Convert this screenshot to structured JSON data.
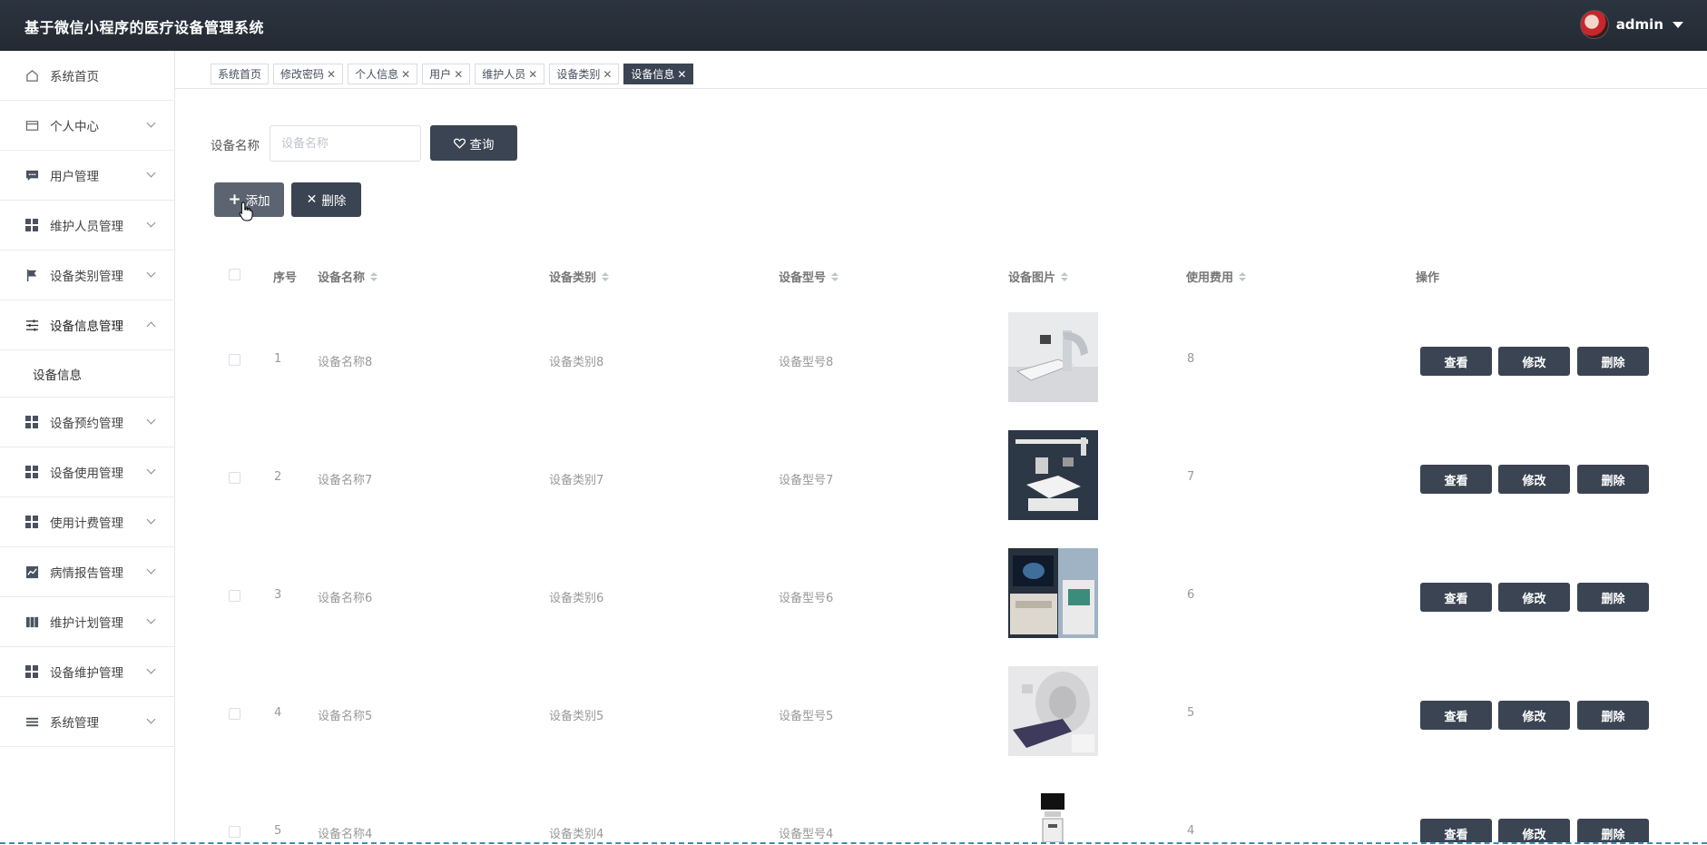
{
  "header": {
    "title": "基于微信小程序的医疗设备管理系统",
    "username": "admin"
  },
  "sidebar": {
    "items": [
      {
        "label": "系统首页",
        "icon": "home-icon"
      },
      {
        "label": "个人中心",
        "icon": "card-icon"
      },
      {
        "label": "用户管理",
        "icon": "chat-icon"
      },
      {
        "label": "维护人员管理",
        "icon": "grid-icon"
      },
      {
        "label": "设备类别管理",
        "icon": "flag-icon"
      },
      {
        "label": "设备信息管理",
        "icon": "sliders-icon",
        "expanded": true
      },
      {
        "label": "设备预约管理",
        "icon": "grid-icon"
      },
      {
        "label": "设备使用管理",
        "icon": "grid-icon"
      },
      {
        "label": "使用计费管理",
        "icon": "grid-icon"
      },
      {
        "label": "病情报告管理",
        "icon": "chart-icon"
      },
      {
        "label": "维护计划管理",
        "icon": "book-icon"
      },
      {
        "label": "设备维护管理",
        "icon": "grid-icon"
      },
      {
        "label": "系统管理",
        "icon": "list-icon"
      }
    ],
    "submenu_label": "设备信息"
  },
  "tabs": [
    "系统首页",
    "修改密码",
    "个人信息",
    "用户",
    "维护人员",
    "设备类别",
    "设备信息"
  ],
  "search": {
    "label": "设备名称",
    "placeholder": "设备名称",
    "value": "",
    "button": "查询"
  },
  "actions": {
    "add": "添加",
    "delete": "删除"
  },
  "table": {
    "headers": {
      "index": "序号",
      "name": "设备名称",
      "category": "设备类别",
      "model": "设备型号",
      "image": "设备图片",
      "fee": "使用费用",
      "ops": "操作"
    },
    "rows": [
      {
        "index": "1",
        "name": "设备名称8",
        "category": "设备类别8",
        "model": "设备型号8",
        "fee": "8"
      },
      {
        "index": "2",
        "name": "设备名称7",
        "category": "设备类别7",
        "model": "设备型号7",
        "fee": "7"
      },
      {
        "index": "3",
        "name": "设备名称6",
        "category": "设备类别6",
        "model": "设备型号6",
        "fee": "6"
      },
      {
        "index": "4",
        "name": "设备名称5",
        "category": "设备类别5",
        "model": "设备型号5",
        "fee": "5"
      },
      {
        "index": "5",
        "name": "设备名称4",
        "category": "设备类别4",
        "model": "设备型号4",
        "fee": "4"
      }
    ],
    "op_labels": {
      "view": "查看",
      "edit": "修改",
      "delete": "删除"
    }
  },
  "colors": {
    "header_bg": "#232a33",
    "button_dark": "#3b4452",
    "active_tab": "#3b4452"
  }
}
